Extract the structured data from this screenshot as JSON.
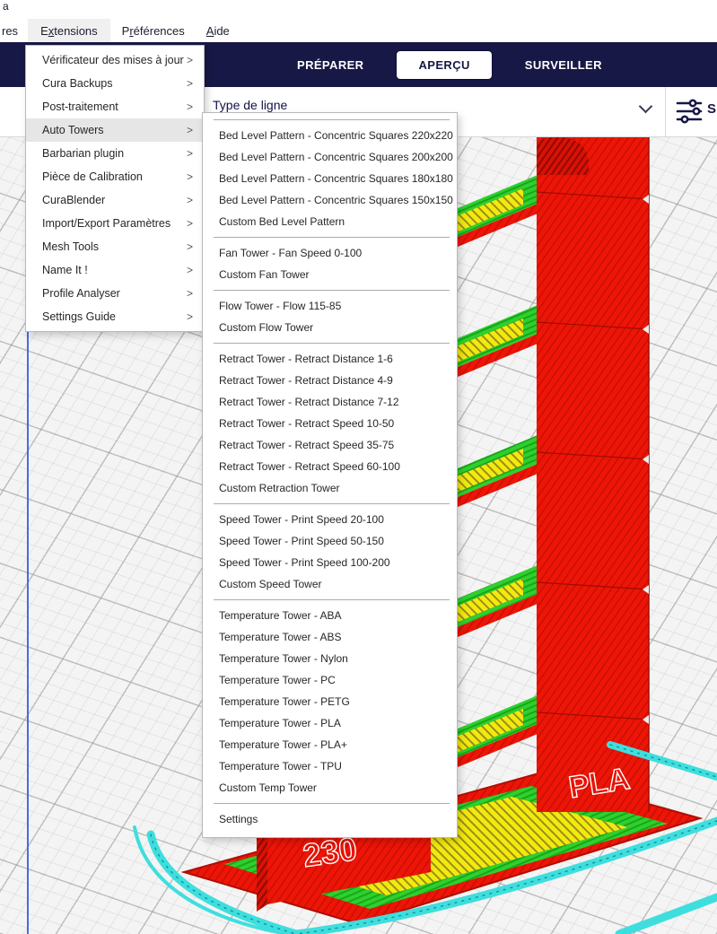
{
  "window": {
    "title_fragment": "a"
  },
  "menubar": {
    "truncated_item": "res",
    "extensions": {
      "pre": "E",
      "key": "x",
      "post": "tensions"
    },
    "preferences": {
      "pre": "P",
      "key": "r",
      "post": "éférences"
    },
    "aide": {
      "pre": "",
      "key": "A",
      "post": "ide"
    }
  },
  "header": {
    "tabs": [
      {
        "label": "PRÉPARER",
        "active": false
      },
      {
        "label": "APERÇU",
        "active": true
      },
      {
        "label": "SURVEILLER",
        "active": false
      }
    ]
  },
  "toolbar": {
    "line_type_label": "Type de ligne",
    "settings_fragment": "S"
  },
  "extensions_menu": {
    "arrow": ">",
    "items": [
      {
        "label": "Vérificateur des mises à jour",
        "highlighted": false
      },
      {
        "label": "Cura Backups",
        "highlighted": false
      },
      {
        "label": "Post-traitement",
        "highlighted": false
      },
      {
        "label": "Auto Towers",
        "highlighted": true
      },
      {
        "label": "Barbarian plugin",
        "highlighted": false
      },
      {
        "label": "Pièce de Calibration",
        "highlighted": false
      },
      {
        "label": "CuraBlender",
        "highlighted": false
      },
      {
        "label": "Import/Export Paramètres",
        "highlighted": false
      },
      {
        "label": "Mesh Tools",
        "highlighted": false
      },
      {
        "label": "Name It !",
        "highlighted": false
      },
      {
        "label": "Profile Analyser",
        "highlighted": false
      },
      {
        "label": "Settings Guide",
        "highlighted": false
      }
    ]
  },
  "auto_towers_menu": {
    "items": [
      "Bed Level Pattern - Concentric Squares 220x220",
      "Bed Level Pattern - Concentric Squares 200x200",
      "Bed Level Pattern - Concentric Squares 180x180",
      "Bed Level Pattern - Concentric Squares 150x150",
      "Custom Bed Level Pattern",
      "Fan Tower - Fan Speed 0-100",
      "Custom Fan Tower",
      "Flow Tower - Flow 115-85",
      "Custom Flow Tower",
      "Retract Tower - Retract Distance 1-6",
      "Retract Tower - Retract Distance 4-9",
      "Retract Tower - Retract Distance 7-12",
      "Retract Tower - Retract Speed 10-50",
      "Retract Tower - Retract Speed 35-75",
      "Retract Tower - Retract Speed 60-100",
      "Custom Retraction Tower",
      "Speed Tower - Print Speed 20-100",
      "Speed Tower - Print Speed 50-150",
      "Speed Tower - Print Speed 100-200",
      "Custom Speed Tower",
      "Temperature Tower - ABA",
      "Temperature Tower - ABS",
      "Temperature Tower - Nylon",
      "Temperature Tower - PC",
      "Temperature Tower - PETG",
      "Temperature Tower - PLA",
      "Temperature Tower - PLA+",
      "Temperature Tower - TPU",
      "Custom Temp Tower",
      "Settings"
    ]
  },
  "scene": {
    "tower_labels": {
      "material": "PLA",
      "temperature": "230"
    },
    "colors": {
      "header_bg": "#181846",
      "menu_highlight": "#e6e6e6",
      "build_line_blue": "#4a6ce0",
      "model_red": "#ee1507",
      "model_green": "#2fcf2f",
      "model_yellow": "#f3e90e",
      "travel_cyan": "#3fdede"
    }
  }
}
